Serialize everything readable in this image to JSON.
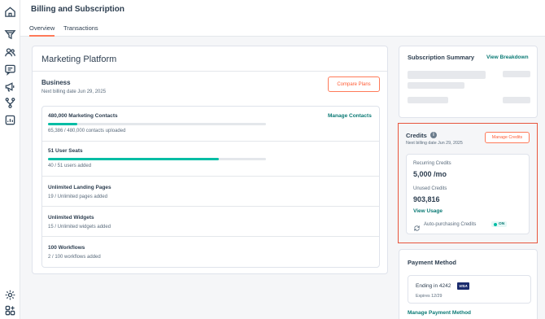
{
  "nav_icons": [
    "home-icon",
    "funnel-icon",
    "contacts-icon",
    "conversations-icon",
    "marketing-megaphone-icon",
    "workflows-icon",
    "reports-icon",
    "settings-gear-icon",
    "marketplace-icon"
  ],
  "header": {
    "title": "Billing and Subscription",
    "tabs": [
      {
        "label": "Overview",
        "active": true
      },
      {
        "label": "Transactions",
        "active": false
      }
    ]
  },
  "marketing": {
    "title": "Marketing Platform",
    "plan_name": "Business",
    "next_billing": "Next billing date Jun 29, 2025",
    "compare_label": "Compare Plans",
    "items": [
      {
        "title": "480,000 Marketing Contacts",
        "subtitle": "65,386 / 480,000 contacts uploaded",
        "progress": 0.136,
        "link": "Manage Contacts"
      },
      {
        "title": "51 User Seats",
        "subtitle": "40 / 51 users added",
        "progress": 0.784
      },
      {
        "title": "Unlimited Landing Pages",
        "subtitle": "19 / Unlimited pages added"
      },
      {
        "title": "Unlimited Widgets",
        "subtitle": "15 / Unlimited widgets added"
      },
      {
        "title": "100 Workflows",
        "subtitle": "2 / 100 workflows added"
      }
    ]
  },
  "summary": {
    "title": "Subscription Summary",
    "link": "View Breakdown"
  },
  "credits": {
    "title": "Credits",
    "next_billing": "Next billing date Jun 29, 2025",
    "manage_label": "Manage Credits",
    "recurring_label": "Recurring Credits",
    "recurring_value": "5,000 /mo",
    "unused_label": "Unused Credits",
    "unused_value": "903,816",
    "usage_link": "View Usage",
    "auto_label": "Auto-purchasing Credits",
    "auto_status": "ON"
  },
  "payment": {
    "title": "Payment Method",
    "ending": "Ending in 4242",
    "card_brand": "VISA",
    "expires": "Expires 12/29",
    "manage_link": "Manage Payment Method"
  },
  "colors": {
    "accent": "#ff7a59",
    "teal": "#00bda5",
    "link": "#0b7a75",
    "highlight": "#e8553d"
  }
}
